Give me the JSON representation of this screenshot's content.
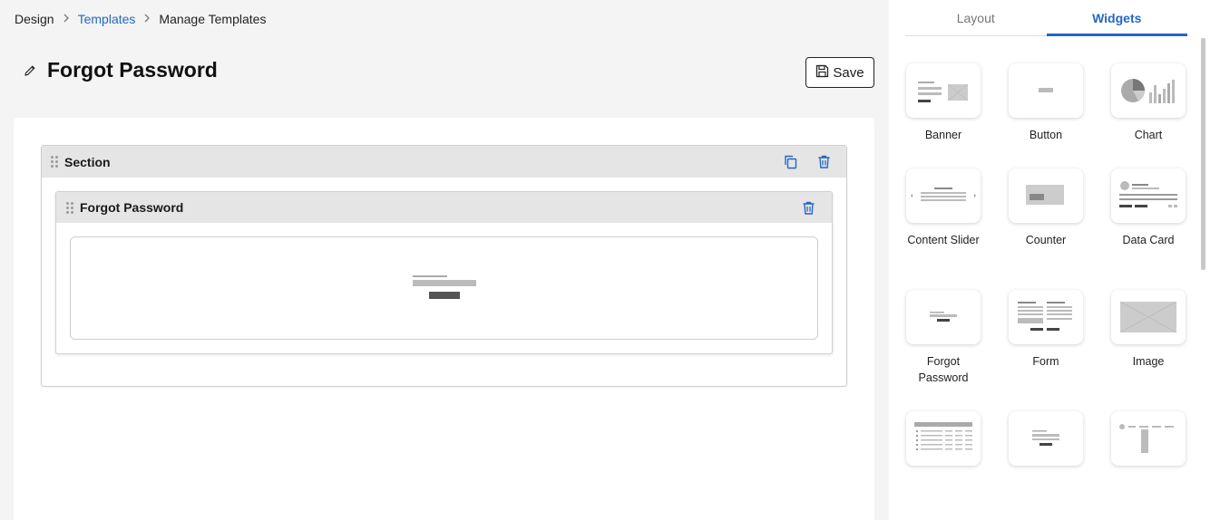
{
  "breadcrumb": {
    "root": "Design",
    "templates": "Templates",
    "current": "Manage Templates"
  },
  "page": {
    "title": "Forgot Password",
    "save_label": "Save"
  },
  "section": {
    "title": "Section"
  },
  "widget": {
    "title": "Forgot Password"
  },
  "tabs": {
    "layout": "Layout",
    "widgets": "Widgets",
    "active": "Widgets"
  },
  "widgets": [
    {
      "label": "Banner",
      "icon": "banner-icon"
    },
    {
      "label": "Button",
      "icon": "button-icon"
    },
    {
      "label": "Chart",
      "icon": "chart-icon"
    },
    {
      "label": "Content Slider",
      "icon": "content-slider-icon"
    },
    {
      "label": "Counter",
      "icon": "counter-icon"
    },
    {
      "label": "Data Card",
      "icon": "data-card-icon"
    },
    {
      "label": "Forgot Password",
      "icon": "forgot-password-icon"
    },
    {
      "label": "Form",
      "icon": "form-icon"
    },
    {
      "label": "Image",
      "icon": "image-icon"
    },
    {
      "label": "",
      "icon": "table-icon"
    },
    {
      "label": "",
      "icon": "login-icon"
    },
    {
      "label": "",
      "icon": "menu-icon"
    }
  ],
  "colors": {
    "accent": "#2467c4",
    "panel_header": "#e5e5e5",
    "background": "#f4f4f4"
  }
}
